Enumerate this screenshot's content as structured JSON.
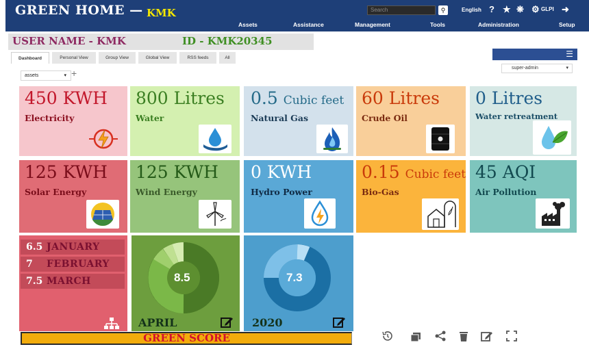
{
  "header": {
    "brand": "GREEN HOME —",
    "brand_sub": "KMK",
    "search_placeholder": "Search",
    "language": "English",
    "user_label": "GLPI",
    "menu": [
      "Assets",
      "Assistance",
      "Management",
      "Tools",
      "Administration",
      "Setup"
    ]
  },
  "user": {
    "name": "USER NAME - KMK",
    "id": "ID - KMK20345"
  },
  "tabs": [
    "Dashboard",
    "Personal View",
    "Group View",
    "Global View",
    "RSS feeds",
    "All"
  ],
  "dashboard_select": "assets",
  "profile_select": "super-admin",
  "cards": [
    {
      "value": "450 KWH",
      "unit": "",
      "label": "Electricity",
      "icon": "electricity-icon"
    },
    {
      "value": "800 Litres",
      "unit": "",
      "label": "Water",
      "icon": "water-drop-hand-icon"
    },
    {
      "value": "0.5",
      "unit": "Cubic feet",
      "label": "Natural Gas",
      "icon": "gas-flame-icon"
    },
    {
      "value": "60 Litres",
      "unit": "",
      "label": "Crude Oil",
      "icon": "oil-barrel-icon"
    },
    {
      "value": "0 Litres",
      "unit": "",
      "label": "Water retreatment",
      "icon": "water-leaf-icon"
    },
    {
      "value": "125 KWH",
      "unit": "",
      "label": "Solar Energy",
      "icon": "solar-panel-icon"
    },
    {
      "value": "125 KWH",
      "unit": "",
      "label": "Wind Energy",
      "icon": "wind-turbine-icon"
    },
    {
      "value": "0 KWH",
      "unit": "",
      "label": "Hydro Power",
      "icon": "hydro-power-icon"
    },
    {
      "value": "0.15",
      "unit": "Cubic feet",
      "label": "Bio-Gas",
      "icon": "biogas-plant-icon"
    },
    {
      "value": "45 AQI",
      "unit": "",
      "label": "Air Pollution",
      "icon": "factory-icon"
    }
  ],
  "months": [
    {
      "value": "6.5",
      "name": "JANUARY"
    },
    {
      "value": "7",
      "name": "FEBRUARY"
    },
    {
      "value": "7.5",
      "name": "MARCH"
    }
  ],
  "april": {
    "value": "8.5",
    "label": "APRIL"
  },
  "year": {
    "value": "7.3",
    "label": "2020"
  },
  "green_score": "GREEN SCORE",
  "colors": {
    "topbar": "#1e3f78",
    "electricity": "#f6c6cc",
    "water": "#d4f0b0",
    "natural_gas": "#d3e1ec",
    "crude_oil": "#f9cf9a",
    "water_retreatment": "#d6e8e5",
    "solar": "#e06c75",
    "wind": "#96c47b",
    "hydro": "#5aa8d6",
    "biogas": "#fbb43c",
    "air": "#7ec5bd",
    "months_card": "#e1606e",
    "april_card": "#6d9e3e",
    "year_card": "#4d9ecd",
    "score": "#f2ac0c"
  }
}
